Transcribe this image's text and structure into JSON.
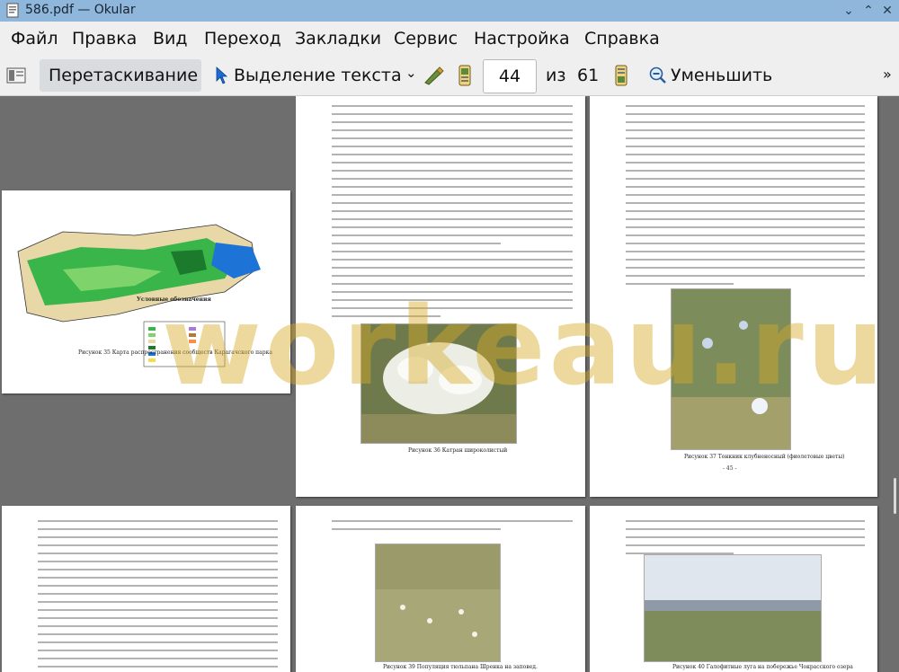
{
  "window": {
    "title": "586.pdf — Okular"
  },
  "menu": [
    "Файл",
    "Правка",
    "Вид",
    "Переход",
    "Закладки",
    "Сервис",
    "Настройка",
    "Справка"
  ],
  "toolbar": {
    "drag_label": "Перетаскивание",
    "select_label": "Выделение текста",
    "page_current": "44",
    "page_of": "из",
    "page_total": "61",
    "zoom_out_label": "Уменьшить"
  },
  "pages": {
    "map_caption": "Рисунок 35 Карта распространения сообществ Карагачского парка",
    "map_legend_title": "Условные обозначения",
    "p44_caption": "Рисунок 36 Катран широколистый",
    "p45_caption": "Рисунок 37 Тонкник клубненосный (фиолетовые цветы)",
    "p45_number": "- 45 -",
    "p47_caption": "Рисунок 39 Популяция тюльпана Шренка на заповед.",
    "p48_caption": "Рисунок 40 Галофитные луга на побережье Чокрасского озера"
  },
  "watermark": "workeau.ru",
  "colors": {
    "titlebar": "#8fb7dc",
    "viewport": "#6e6e6e",
    "watermark": "#d6aa28"
  }
}
